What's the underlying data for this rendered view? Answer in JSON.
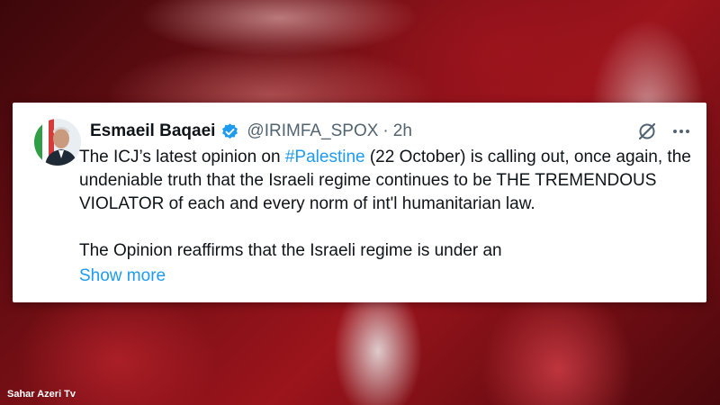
{
  "tweet": {
    "author_name": "Esmaeil Baqaei",
    "handle": "@IRIMFA_SPOX",
    "separator": "·",
    "time": "2h",
    "text_before_hashtag": "The ICJ’s latest opinion on ",
    "hashtag": "#Palestine",
    "text_after_hashtag": " (22 October) is calling out, once again, the undeniable truth that the Israeli regime continues to be THE TREMENDOUS VIOLATOR of each and every norm of int'l humanitarian law.",
    "paragraph2": "The Opinion reaffirms that the Israeli regime is under an",
    "show_more": "Show more",
    "icons": {
      "verified": "verified-badge-icon",
      "grok": "grok-icon",
      "more": "more-options-icon"
    }
  },
  "watermark": "Sahar Azeri Tv",
  "colors": {
    "link": "#1d9bf0",
    "verified": "#1d9bf0",
    "text": "#0f1419",
    "muted": "#536471",
    "background": "#7b1016"
  }
}
